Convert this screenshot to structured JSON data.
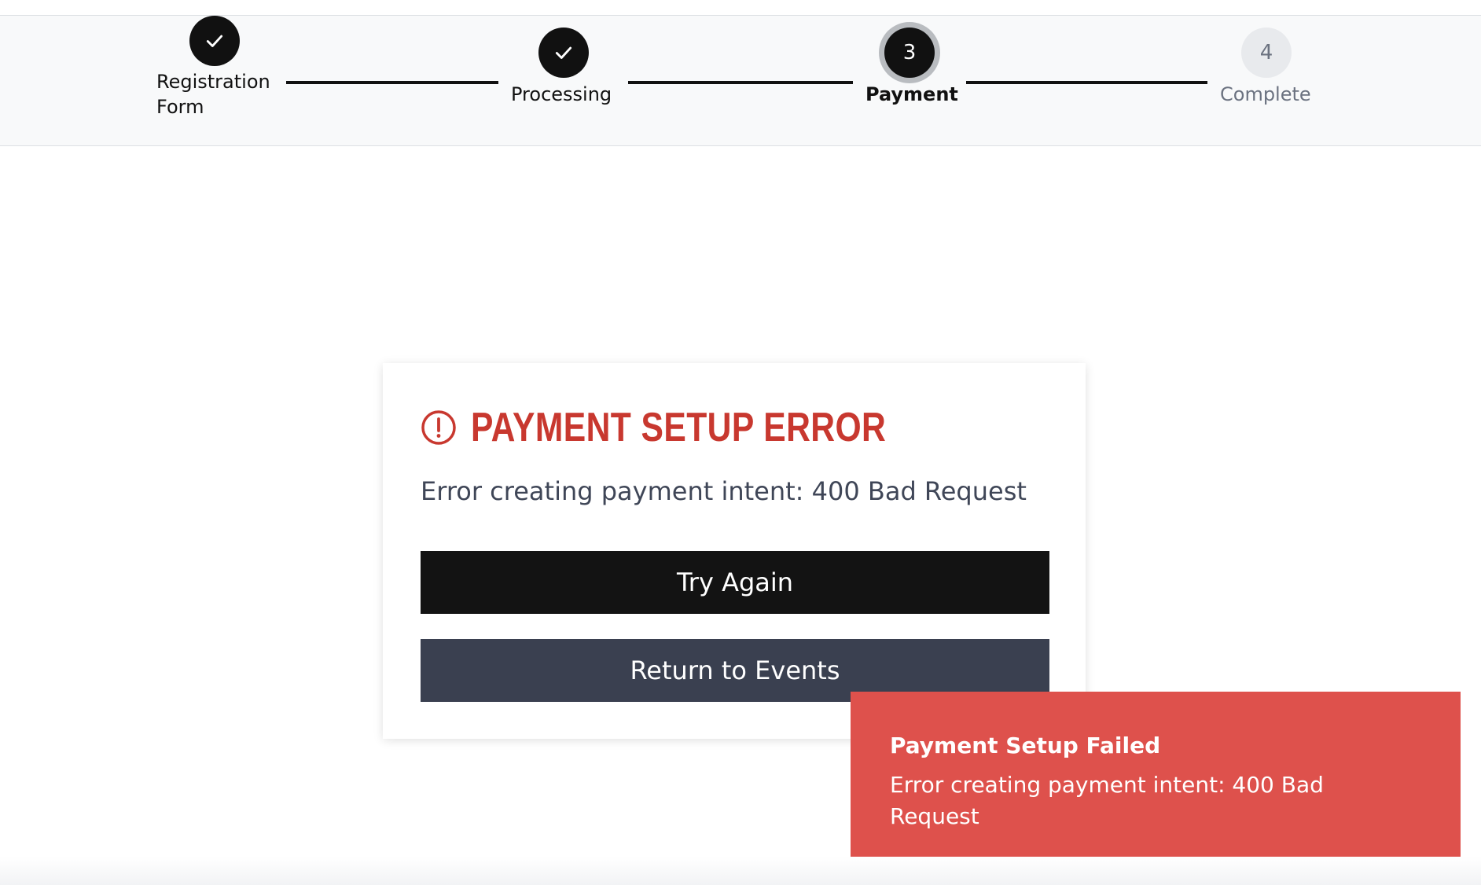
{
  "stepper": {
    "steps": [
      {
        "label": "Registration Form",
        "state": "done",
        "icon": "check-icon"
      },
      {
        "label": "Processing",
        "state": "done",
        "icon": "check-icon"
      },
      {
        "label": "Payment",
        "number": "3",
        "state": "current"
      },
      {
        "label": "Complete",
        "number": "4",
        "state": "todo"
      }
    ]
  },
  "error_card": {
    "icon": "alert-circle-icon",
    "title": "PAYMENT SETUP ERROR",
    "message": "Error creating payment intent: 400 Bad Request",
    "try_again_label": "Try Again",
    "return_label": "Return to Events"
  },
  "toast": {
    "title": "Payment Setup Failed",
    "message": "Error creating payment intent: 400 Bad Request"
  },
  "colors": {
    "error_red": "#c8382f",
    "toast_red": "#de514c",
    "primary_dark": "#131313",
    "secondary_dark": "#3a4050"
  }
}
